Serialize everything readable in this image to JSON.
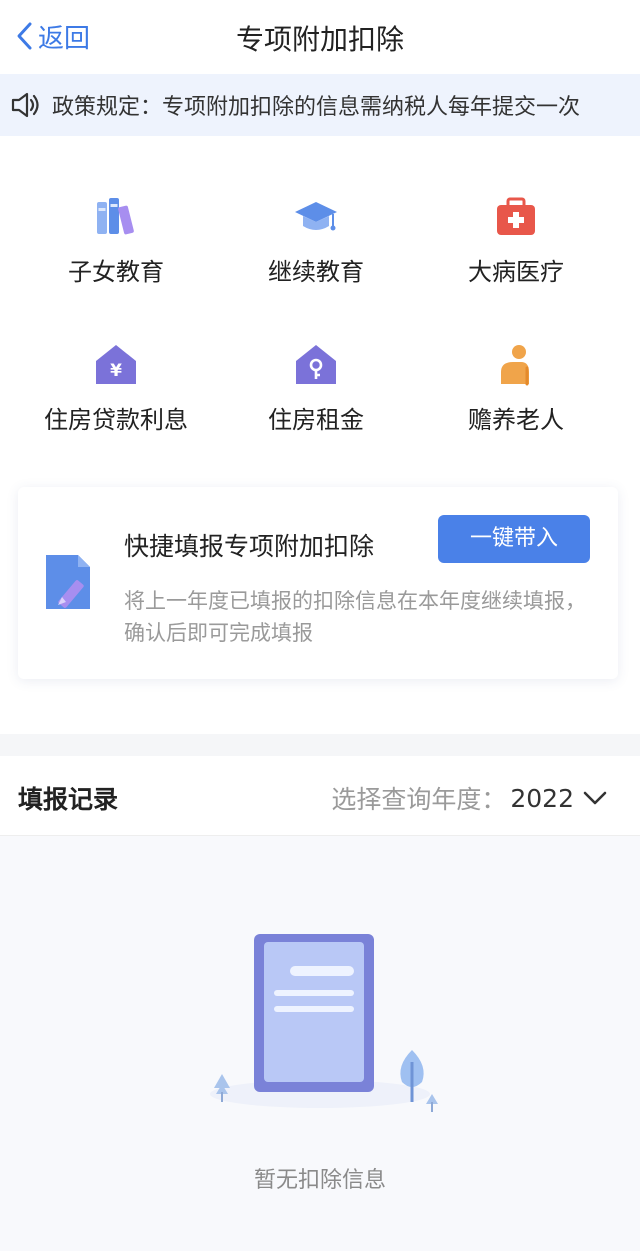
{
  "header": {
    "back_label": "返回",
    "title": "专项附加扣除"
  },
  "notice": {
    "icon": "speaker-icon",
    "text": "政策规定：专项附加扣除的信息需纳税人每年提交一次"
  },
  "categories": [
    {
      "label": "子女教育",
      "icon": "books-icon"
    },
    {
      "label": "继续教育",
      "icon": "graduation-cap-icon"
    },
    {
      "label": "大病医疗",
      "icon": "medical-kit-icon"
    },
    {
      "label": "住房贷款利息",
      "icon": "house-yuan-icon"
    },
    {
      "label": "住房租金",
      "icon": "house-key-icon"
    },
    {
      "label": "赡养老人",
      "icon": "elderly-person-icon"
    }
  ],
  "quick_fill": {
    "icon": "document-edit-icon",
    "title": "快捷填报专项附加扣除",
    "button_label": "一键带入",
    "description": "将上一年度已填报的扣除信息在本年度继续填报，确认后即可完成填报"
  },
  "records": {
    "title": "填报记录",
    "year_label": "选择查询年度：",
    "year_value": "2022",
    "empty_text": "暂无扣除信息"
  },
  "colors": {
    "accent": "#4a81e8",
    "link": "#3d7ae6",
    "notice_bg": "#eef3fd",
    "purple": "#7b72d9",
    "red": "#e8574a",
    "orange": "#f0a44a"
  }
}
